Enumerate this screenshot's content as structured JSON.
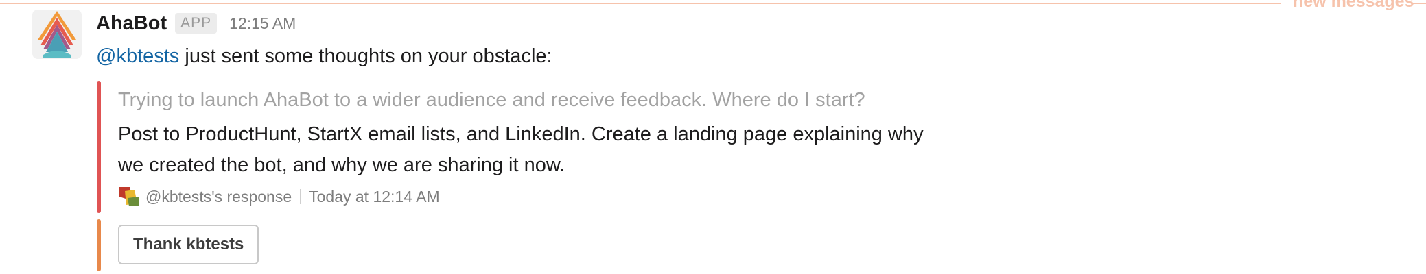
{
  "divider": {
    "label": "new messages",
    "color": "#f6c3ac"
  },
  "message": {
    "bot_name": "AhaBot",
    "app_badge": "APP",
    "time": "12:15 AM",
    "mention": "@kbtests",
    "text": " just sent some thoughts on your obstacle:",
    "avatar_icon": "ahabot-logo-icon"
  },
  "attachment": {
    "bar_color": "#e05454",
    "quote": "Trying to launch AhaBot to a wider audience and receive feedback. Where do I start?",
    "answer": "Post to ProductHunt, StartX email lists, and LinkedIn. Create a landing page explaining why we created the bot, and why we are sharing it now.",
    "footer_icon": "user-avatar-icon",
    "footer_author": "@kbtests's response",
    "footer_time": "Today at 12:14 AM"
  },
  "actions": {
    "bar_color": "#e8894b",
    "thank_button": "Thank kbtests"
  },
  "colors": {
    "mention": "#1264a3",
    "muted_text": "#a2a2a2"
  }
}
